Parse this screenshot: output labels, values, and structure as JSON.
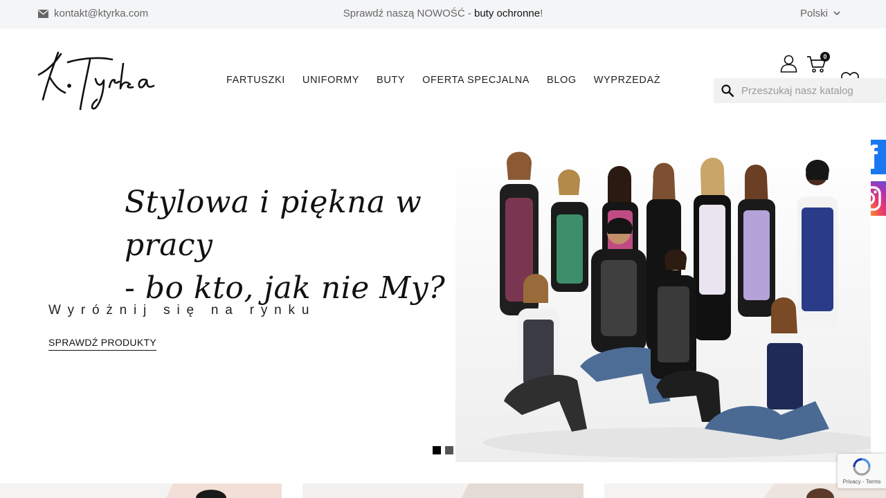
{
  "topbar": {
    "email": "kontakt@ktyrka.com",
    "promo_prefix": "Sprawdź naszą NOWOŚĆ - ",
    "promo_link": "buty ochronne",
    "promo_suffix": "!",
    "language": "Polski"
  },
  "header": {
    "nav": [
      "FARTUSZKI",
      "UNIFORMY",
      "BUTY",
      "OFERTA SPECJALNA",
      "BLOG",
      "WYPRZEDAŻ"
    ],
    "cart_count": "0",
    "search_placeholder": "Przeszukaj nasz katalog"
  },
  "hero": {
    "title_line1": "Stylowa i piękna w pracy",
    "title_line2": "- bo kto, jak nie My?",
    "subtitle": "Wyróżnij się na rynku",
    "cta": "SPRAWDŹ PRODUKTY",
    "slides_total": 2,
    "active_slide": 1
  },
  "recaptcha": {
    "links": "Privacy - Terms"
  },
  "colors": {
    "facebook": "#1a77f2",
    "text_dark": "#111111",
    "topbar_bg": "#f4f5f7"
  }
}
